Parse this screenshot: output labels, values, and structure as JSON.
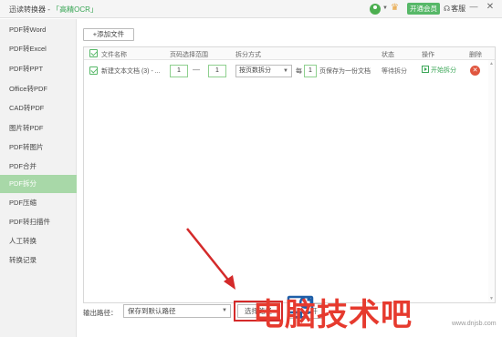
{
  "titlebar": {
    "app_name": "迅读转换器 - ",
    "app_sub": "「高精OCR」",
    "vip_label": "开通会员",
    "service_label": "客服",
    "minimize": "—",
    "close": "✕"
  },
  "sidebar": {
    "items": [
      {
        "label": "PDF转Word"
      },
      {
        "label": "PDF转Excel"
      },
      {
        "label": "PDF转PPT"
      },
      {
        "label": "Office转PDF"
      },
      {
        "label": "CAD转PDF"
      },
      {
        "label": "图片转PDF"
      },
      {
        "label": "PDF转图片"
      },
      {
        "label": "PDF合并"
      },
      {
        "label": "PDF拆分"
      },
      {
        "label": "PDF压缩"
      },
      {
        "label": "PDF转扫描件"
      },
      {
        "label": "人工转换"
      },
      {
        "label": "转换记录"
      }
    ],
    "active_index": 8
  },
  "toolbar": {
    "add_file": "+添加文件"
  },
  "table": {
    "headers": {
      "filename": "文件名称",
      "page_range": "页码选择范围",
      "split_mode": "拆分方式",
      "status": "状态",
      "operation": "操作",
      "delete": "删除"
    },
    "rows": [
      {
        "filename": "新建文本文档 (3) - ...",
        "page_from": "1",
        "dash": "—",
        "page_to": "1",
        "split_mode": "按页数拆分",
        "each_prefix": "每",
        "each_value": "1",
        "each_suffix": "页保存为一份文档",
        "status": "等待拆分",
        "operation": "开始拆分",
        "delete": "✕"
      }
    ]
  },
  "bottom": {
    "output_label": "输出路径：",
    "output_value": "保存到默认路径",
    "choose_path": "选择路径",
    "open_label": "打开"
  },
  "watermark": {
    "text": "电脑技术吧",
    "sub": "www.dnjsb.com"
  },
  "colors": {
    "accent": "#57b868",
    "active_sidebar": "#a8d8a8",
    "annotation_red": "#d42a2a",
    "delete_red": "#e0563f"
  }
}
